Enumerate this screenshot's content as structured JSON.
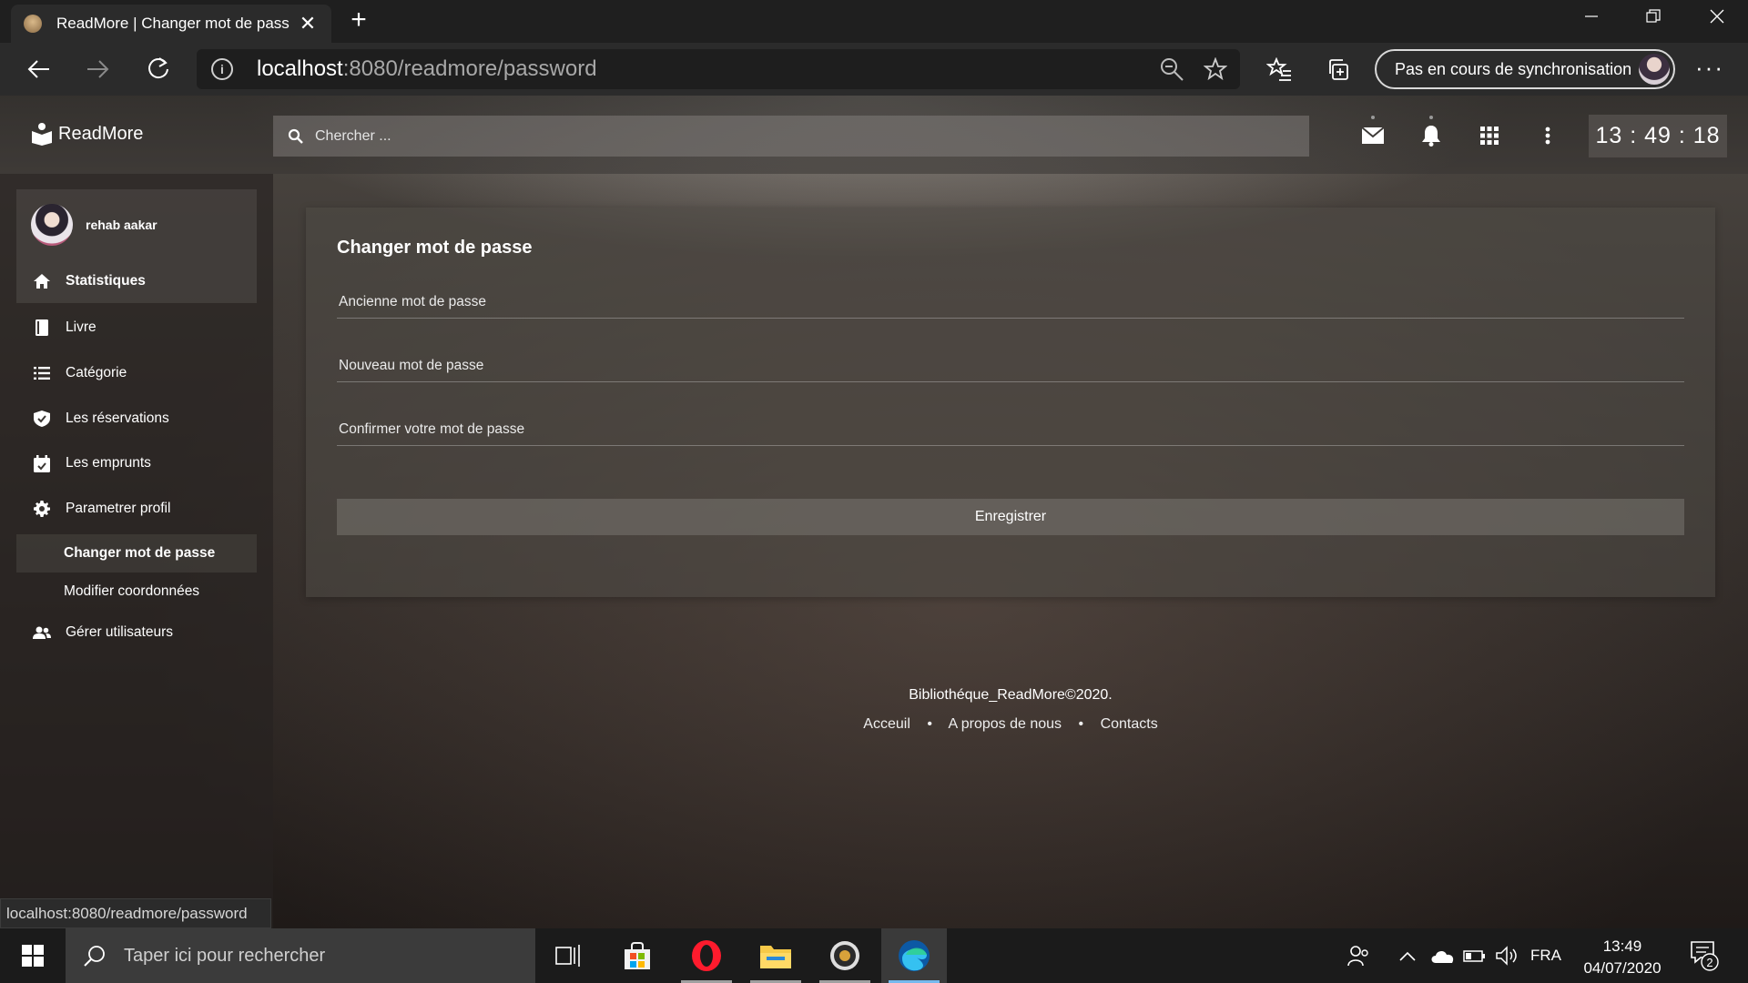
{
  "browser": {
    "tab_title": "ReadMore | Changer mot de passe",
    "url_host": "localhost",
    "url_path": ":8080/readmore/password",
    "sync_label": "Pas en cours de synchronisation",
    "status_url": "localhost:8080/readmore/password"
  },
  "app": {
    "brand": "ReadMore",
    "search_placeholder": "Chercher ...",
    "clock": "13 : 49 : 18"
  },
  "sidebar": {
    "user_name": "rehab aakar",
    "items": [
      {
        "label": "Statistiques",
        "icon": "home-icon"
      },
      {
        "label": "Livre",
        "icon": "book-icon"
      },
      {
        "label": "Catégorie",
        "icon": "list-icon"
      },
      {
        "label": "Les réservations",
        "icon": "shield-check-icon"
      },
      {
        "label": "Les emprunts",
        "icon": "calendar-check-icon"
      },
      {
        "label": "Parametrer profil",
        "icon": "gear-icon"
      }
    ],
    "sub_items": [
      {
        "label": "Changer mot de passe"
      },
      {
        "label": "Modifier coordonnées"
      }
    ],
    "manage_users": {
      "label": "Gérer utilisateurs",
      "icon": "users-icon"
    }
  },
  "form": {
    "title": "Changer mot de passe",
    "old_password_placeholder": "Ancienne mot de passe",
    "new_password_placeholder": "Nouveau mot de passe",
    "confirm_password_placeholder": "Confirmer votre mot de passe",
    "submit_label": "Enregistrer"
  },
  "footer": {
    "copyright": "Bibliothéque_ReadMore©2020.",
    "links": [
      "Acceuil",
      "A propos de nous",
      "Contacts"
    ]
  },
  "taskbar": {
    "search_placeholder": "Taper ici pour rechercher",
    "language": "FRA",
    "time": "13:49",
    "date": "04/07/2020",
    "notification_count": "2"
  }
}
